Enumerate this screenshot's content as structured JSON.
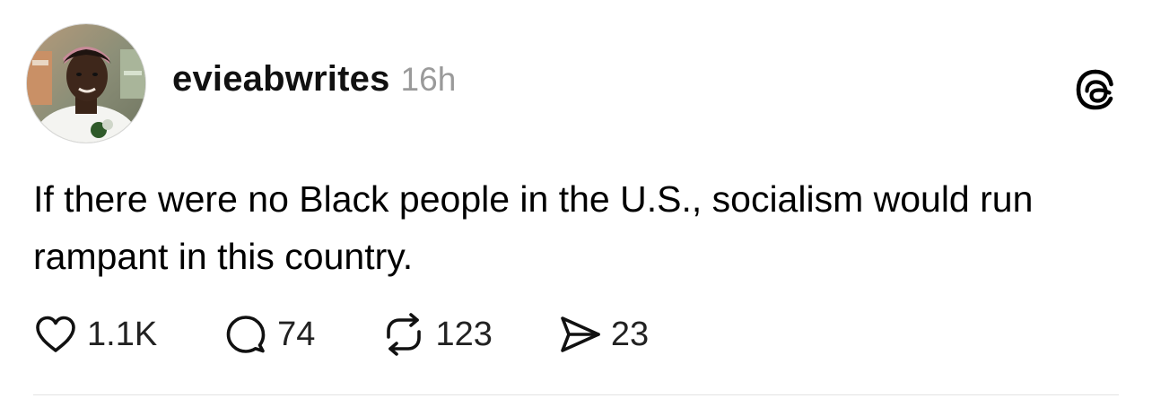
{
  "post": {
    "username": "evieabwrites",
    "timestamp": "16h",
    "text": "If there were no Black people in the U.S., socialism would run rampant in this country.",
    "actions": {
      "likes": "1.1K",
      "replies": "74",
      "reposts": "123",
      "shares": "23"
    },
    "icons": {
      "like": "heart-icon",
      "reply": "speech-bubble-icon",
      "repost": "repost-arrows-icon",
      "share": "paper-plane-icon",
      "brand": "threads-logo-icon"
    }
  }
}
